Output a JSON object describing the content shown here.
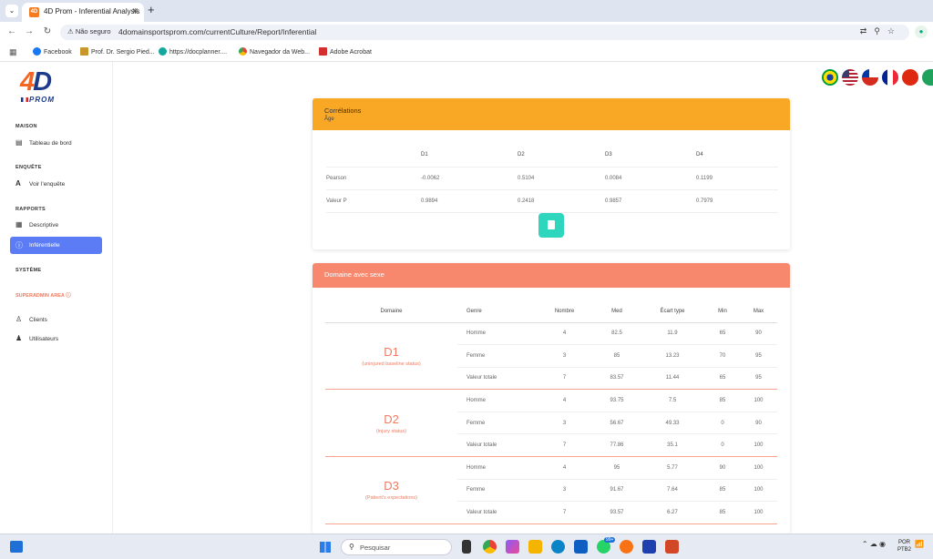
{
  "browser": {
    "tab_title": "4D Prom - Inferential Analysis",
    "security_label": "Não seguro",
    "url": "4domainsportsprom.com/currentCulture/Report/Inferential",
    "bookmarks": [
      "Facebook",
      "Prof. Dr. Sergio Pied...",
      "https://docplanner....",
      "Navegador da Web...",
      "Adobe Acrobat"
    ]
  },
  "logo": {
    "main": "4D",
    "sub": "PROM"
  },
  "sidebar": {
    "sections": {
      "maison": "MAISON",
      "enquete": "ENQUÊTE",
      "rapports": "RAPPORTS",
      "systeme": "SYSTÈME"
    },
    "items": {
      "tableau": "Tableau de bord",
      "voir": "Voir l'enquête",
      "descriptive": "Descriptive",
      "inferentielle": "Inférentielle",
      "clients": "Clients",
      "utilisateurs": "Utilisateurs"
    },
    "superadmin": "SUPERADMIN AREA ⓘ"
  },
  "correlations": {
    "title": "Corrélations",
    "subtitle": "Âge",
    "headers": [
      "",
      "D1",
      "D2",
      "D3",
      "D4"
    ],
    "rows": [
      {
        "label": "Pearson",
        "values": [
          "-0.0062",
          "0.5104",
          "0.0084",
          "0.1199"
        ]
      },
      {
        "label": "Valeur P",
        "values": [
          "0.9894",
          "0.2418",
          "0.9857",
          "0.7979"
        ]
      }
    ]
  },
  "domaine": {
    "title": "Domaine avec sexe",
    "headers": [
      "Domaine",
      "Genre",
      "Nombre",
      "Med",
      "Écart type",
      "Min",
      "Max"
    ],
    "groups": [
      {
        "name": "D1",
        "description": "(uninjured baseline status)",
        "rows": [
          [
            "Homme",
            "4",
            "82.5",
            "11.9",
            "65",
            "90"
          ],
          [
            "Femme",
            "3",
            "85",
            "13.23",
            "70",
            "95"
          ],
          [
            "Valeur totale",
            "7",
            "83.57",
            "11.44",
            "65",
            "95"
          ]
        ]
      },
      {
        "name": "D2",
        "description": "(injury status)",
        "rows": [
          [
            "Homme",
            "4",
            "93.75",
            "7.5",
            "85",
            "100"
          ],
          [
            "Femme",
            "3",
            "56.67",
            "49.33",
            "0",
            "90"
          ],
          [
            "Valeur totale",
            "7",
            "77.86",
            "35.1",
            "0",
            "100"
          ]
        ]
      },
      {
        "name": "D3",
        "description": "(Patient's expectations)",
        "rows": [
          [
            "Homme",
            "4",
            "95",
            "5.77",
            "90",
            "100"
          ],
          [
            "Femme",
            "3",
            "91.67",
            "7.64",
            "85",
            "100"
          ],
          [
            "Valeur totale",
            "7",
            "93.57",
            "6.27",
            "85",
            "100"
          ]
        ]
      }
    ]
  },
  "taskbar": {
    "search_placeholder": "Pesquisar",
    "badge": "99+",
    "lang": "POR",
    "layout": "PTB2"
  }
}
